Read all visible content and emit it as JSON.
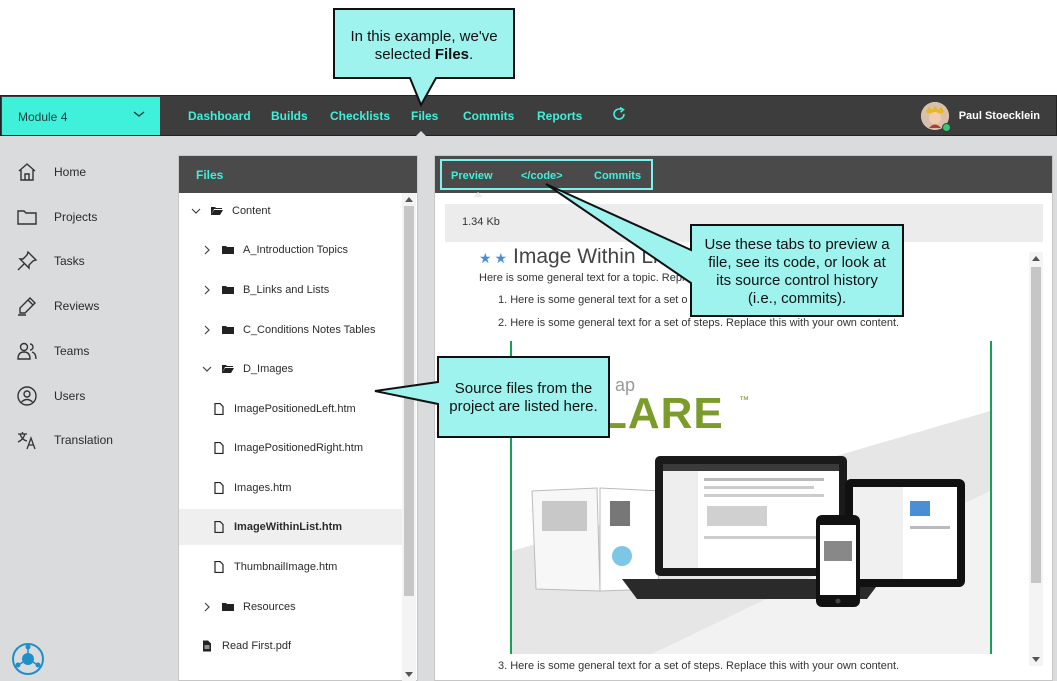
{
  "callouts": {
    "files_selected": {
      "line1": "In this example, we've",
      "line2_prefix": "selected ",
      "line2_bold": "Files",
      "line2_suffix": "."
    },
    "tabs_info": {
      "line1": "Use these tabs to preview a",
      "line2": "file, see its code, or look at",
      "line3": "its source control history",
      "line4": "(i.e., commits)."
    },
    "source_files": {
      "line1": "Source files from the",
      "line2": "project are listed here."
    }
  },
  "topbar": {
    "module_label": "Module 4",
    "nav": [
      "Dashboard",
      "Builds",
      "Checklists",
      "Files",
      "Commits",
      "Reports"
    ],
    "active_nav": "Files",
    "user_name": "Paul Stoecklein"
  },
  "sidebar": {
    "items": [
      {
        "label": "Home",
        "icon": "home-icon"
      },
      {
        "label": "Projects",
        "icon": "folder-icon"
      },
      {
        "label": "Tasks",
        "icon": "pin-icon"
      },
      {
        "label": "Reviews",
        "icon": "pen-icon"
      },
      {
        "label": "Teams",
        "icon": "team-icon"
      },
      {
        "label": "Users",
        "icon": "user-circle-icon"
      },
      {
        "label": "Translation",
        "icon": "translate-icon"
      }
    ]
  },
  "files_panel": {
    "title": "Files",
    "tree": [
      {
        "label": "Content",
        "type": "folder-open",
        "level": 0,
        "expanded": true
      },
      {
        "label": "A_Introduction Topics",
        "type": "folder",
        "level": 1
      },
      {
        "label": "B_Links and Lists",
        "type": "folder",
        "level": 1
      },
      {
        "label": "C_Conditions Notes Tables",
        "type": "folder",
        "level": 1
      },
      {
        "label": "D_Images",
        "type": "folder-open",
        "level": 1,
        "expanded": true
      },
      {
        "label": "ImagePositionedLeft.htm",
        "type": "file",
        "level": 2
      },
      {
        "label": "ImagePositionedRight.htm",
        "type": "file",
        "level": 2
      },
      {
        "label": "Images.htm",
        "type": "file",
        "level": 2
      },
      {
        "label": "ImageWithinList.htm",
        "type": "file",
        "level": 2,
        "selected": true
      },
      {
        "label": "ThumbnailImage.htm",
        "type": "file",
        "level": 2
      },
      {
        "label": "Resources",
        "type": "folder",
        "level": 1
      },
      {
        "label": "Read First.pdf",
        "type": "pdf",
        "level": 0
      }
    ]
  },
  "preview_panel": {
    "tabs": [
      "Preview",
      "</code>",
      "Commits"
    ],
    "active_tab": "Preview",
    "file_size": "1.34 Kb",
    "doc": {
      "title": "Image Within Li",
      "intro": "Here is some general text for a topic. Repl",
      "step1": "1. Here is some general text for a set o",
      "step2": "2. Here is some general text for a set of steps. Replace this with your own content.",
      "step3": "3. Here is some general text for a set of steps. Replace this with your own content.",
      "image_logo_small": "ap",
      "image_logo": "LARE",
      "image_mark": "™"
    }
  },
  "colors": {
    "accent": "#3ff0da",
    "topbar": "#3d3d3d",
    "panel_header": "#4a4a4a",
    "callout_fill": "#9ef3ef",
    "frame_green": "#17a05a"
  }
}
